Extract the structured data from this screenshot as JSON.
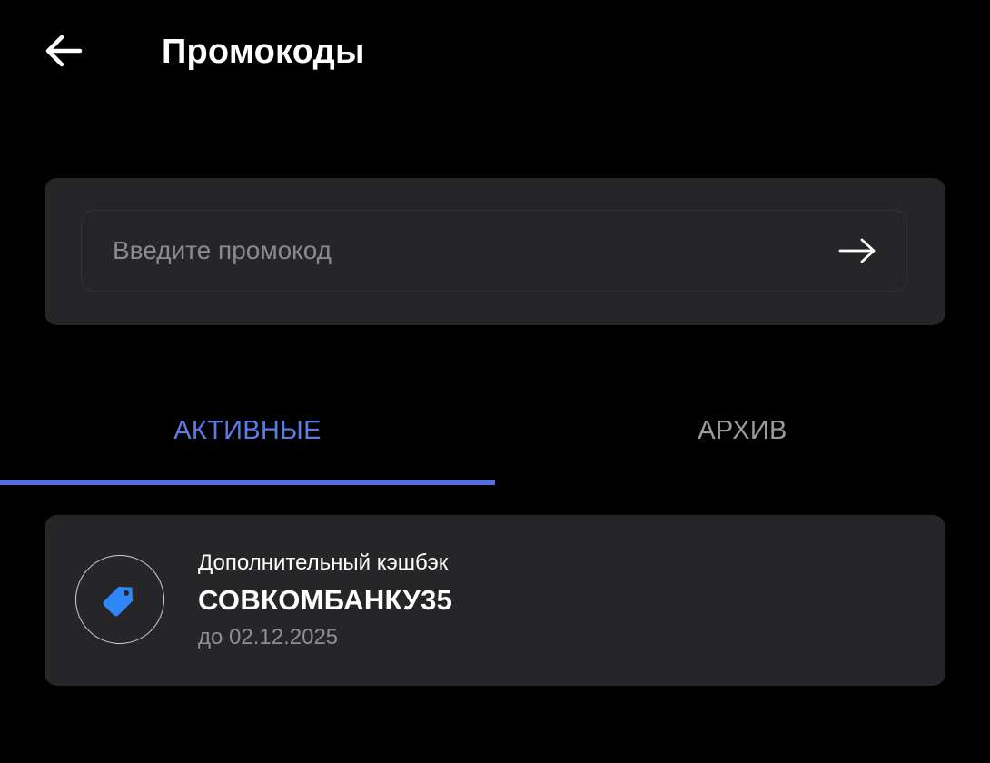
{
  "header": {
    "title": "Промокоды",
    "back_icon": "arrow-left-icon"
  },
  "promo_input": {
    "placeholder": "Введите промокод",
    "value": "",
    "submit_icon": "arrow-right-icon"
  },
  "tabs": [
    {
      "label": "АКТИВНЫЕ",
      "active": true
    },
    {
      "label": "АРХИВ",
      "active": false
    }
  ],
  "promocodes": [
    {
      "subtitle": "Дополнительный кэшбэк",
      "code": "СОВКОМБАНКУ35",
      "expiry": "до 02.12.2025",
      "icon": "price-tag-icon",
      "icon_color": "#2f86f6"
    }
  ],
  "colors": {
    "background": "#000000",
    "panel": "#262628",
    "accent": "#4d6fe0",
    "tab_active_text": "#5b7be6",
    "tab_inactive_text": "#9a9a9e",
    "muted_text": "#8f8f93"
  }
}
